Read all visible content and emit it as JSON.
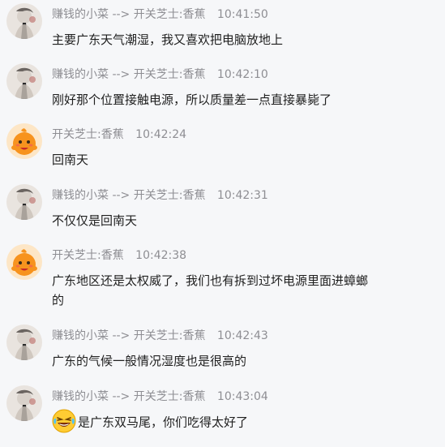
{
  "messages": [
    {
      "sender": "赚钱的小菜",
      "arrow": "-->",
      "receiver": "开关芝士:香蕉",
      "time": "10:41:50",
      "text": "主要广东天气潮湿，我又喜欢把电脑放地上",
      "avatar": "sketch-avatar"
    },
    {
      "sender": "赚钱的小菜",
      "arrow": "-->",
      "receiver": "开关芝士:香蕉",
      "time": "10:42:10",
      "text": "刚好那个位置接触电源，所以质量差一点直接暴毙了",
      "avatar": "sketch-avatar"
    },
    {
      "sender": "开关芝士:香蕉",
      "time": "10:42:24",
      "text": "回南天",
      "avatar": "orange-mascot-avatar"
    },
    {
      "sender": "赚钱的小菜",
      "arrow": "-->",
      "receiver": "开关芝士:香蕉",
      "time": "10:42:31",
      "text": "不仅仅是回南天",
      "avatar": "sketch-avatar"
    },
    {
      "sender": "开关芝士:香蕉",
      "time": "10:42:38",
      "text": "广东地区还是太权威了，我们也有拆到过坏电源里面进蟑螂的",
      "avatar": "orange-mascot-avatar"
    },
    {
      "sender": "赚钱的小菜",
      "arrow": "-->",
      "receiver": "开关芝士:香蕉",
      "time": "10:42:43",
      "text": "广东的气候一般情况湿度也是很高的",
      "avatar": "sketch-avatar"
    },
    {
      "sender": "赚钱的小菜",
      "arrow": "-->",
      "receiver": "开关芝士:香蕉",
      "time": "10:43:04",
      "text": "是广东双马尾，你们吃得太好了",
      "avatar": "sketch-avatar",
      "leading_emoji": "laughing-tears-emoji"
    }
  ],
  "colors": {
    "background": "#f6f7f9",
    "meta_text": "#8e8e93",
    "message_text": "#1f1f1f",
    "mascot_orange": "#f7931e"
  }
}
